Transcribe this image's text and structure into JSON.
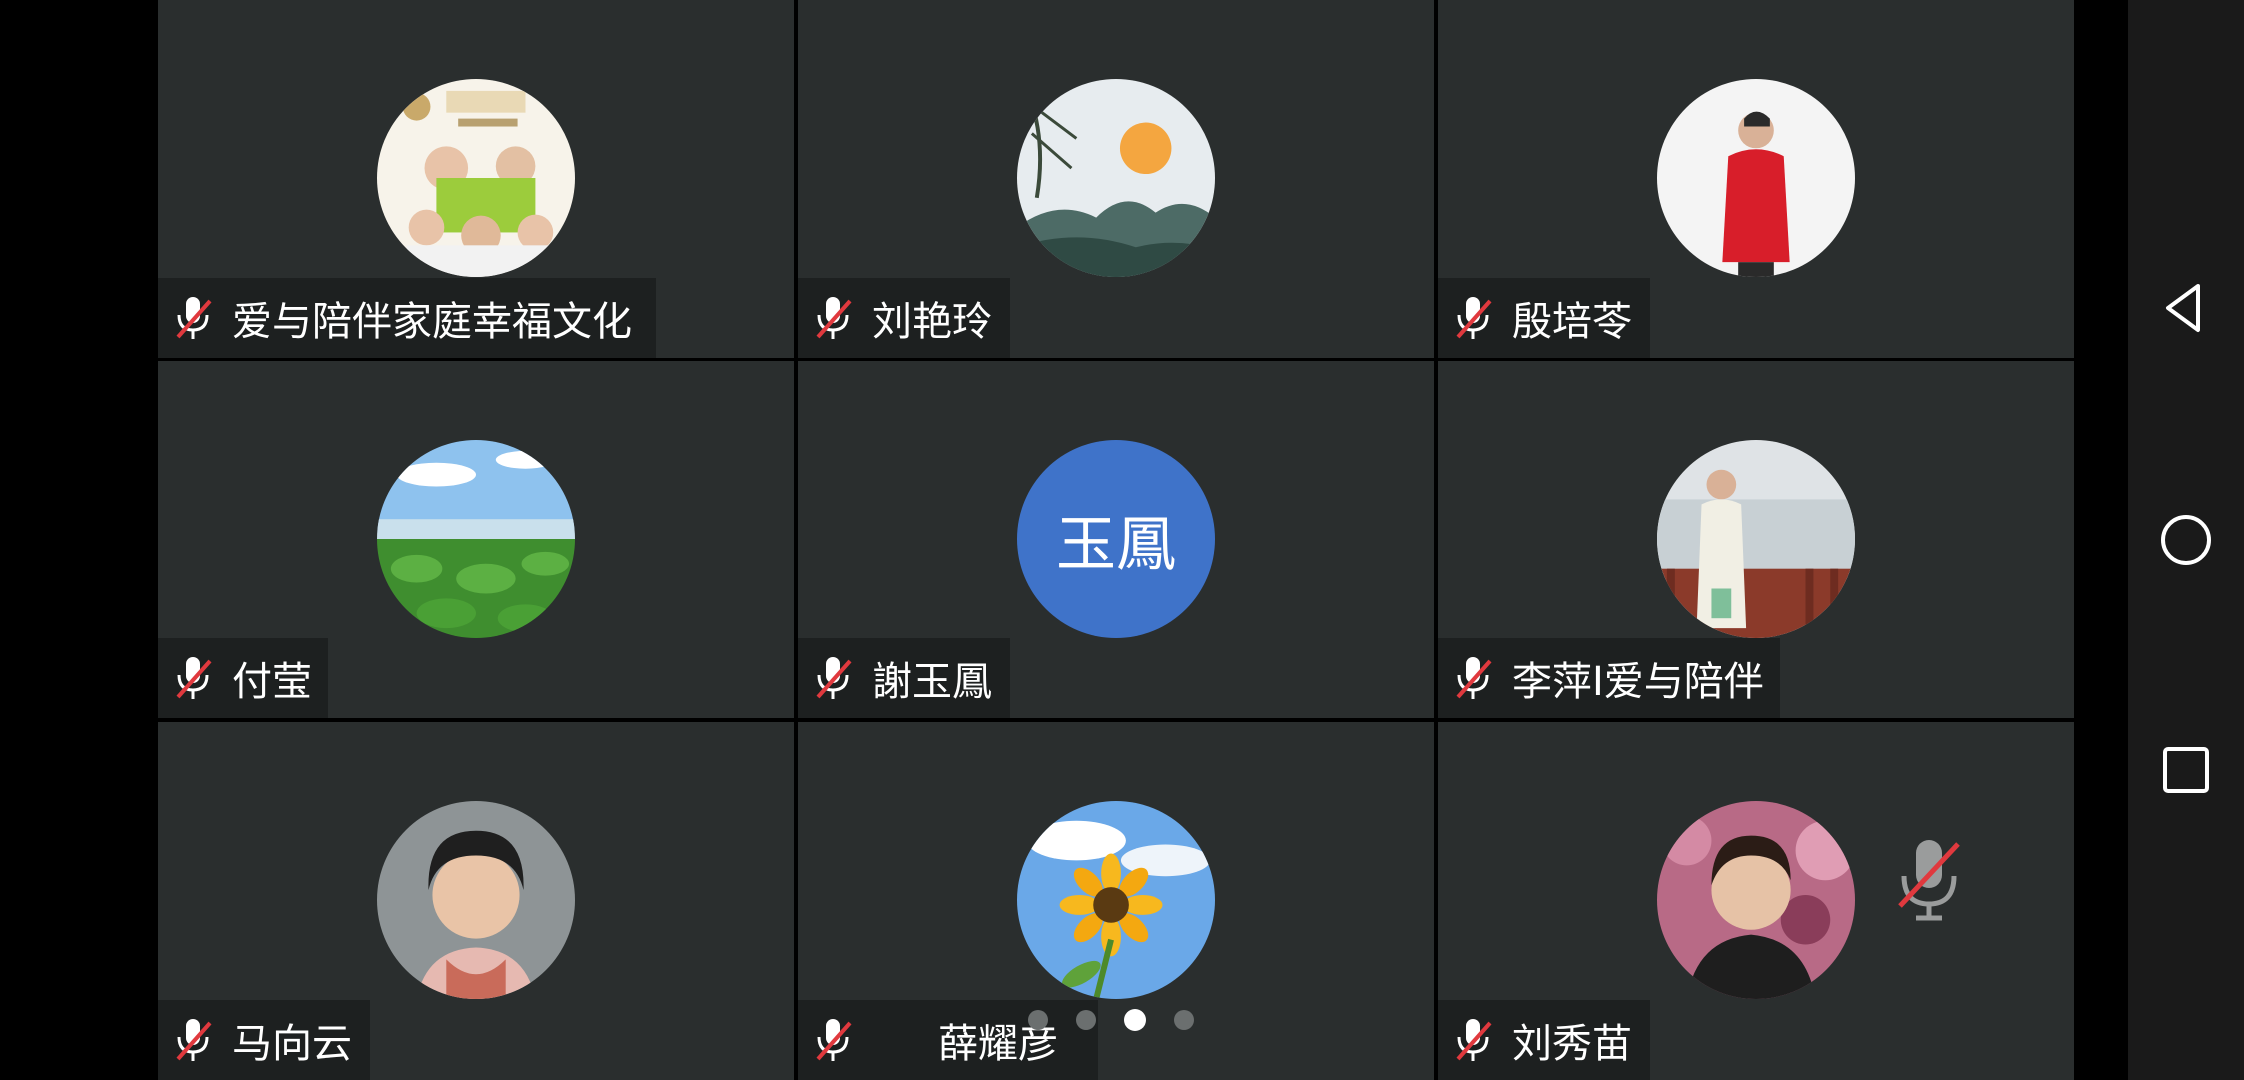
{
  "participants": [
    {
      "name": "爱与陪伴家庭幸福文化",
      "avatar": "poster-avatar",
      "muted": true
    },
    {
      "name": "刘艳玲",
      "avatar": "sunset-landscape-avatar",
      "muted": true
    },
    {
      "name": "殷培苓",
      "avatar": "red-hoodie-person-avatar",
      "muted": true
    },
    {
      "name": "付莹",
      "avatar": "lotus-field-avatar",
      "muted": true
    },
    {
      "name": "謝玉鳳",
      "avatar_initials": "玉鳳",
      "muted": true
    },
    {
      "name": "李萍I爱与陪伴",
      "avatar": "lakeside-person-avatar",
      "muted": true
    },
    {
      "name": "马向云",
      "avatar": "woman-selfie-avatar",
      "muted": true
    },
    {
      "name": "薛耀彦",
      "avatar": "sunflower-avatar",
      "muted": true
    },
    {
      "name": "刘秀苗",
      "avatar": "woman-blossoms-avatar",
      "muted": true
    }
  ],
  "pager": {
    "pages": 4,
    "current": 3
  },
  "colors": {
    "tile_bg": "#2a2e2e",
    "label_bg": "#1d2020",
    "mute_red": "#e0393e",
    "initials_avatar": "#3f73c9"
  },
  "navbar": {
    "icons": [
      "back-triangle-icon",
      "home-circle-icon",
      "recents-square-icon"
    ]
  }
}
